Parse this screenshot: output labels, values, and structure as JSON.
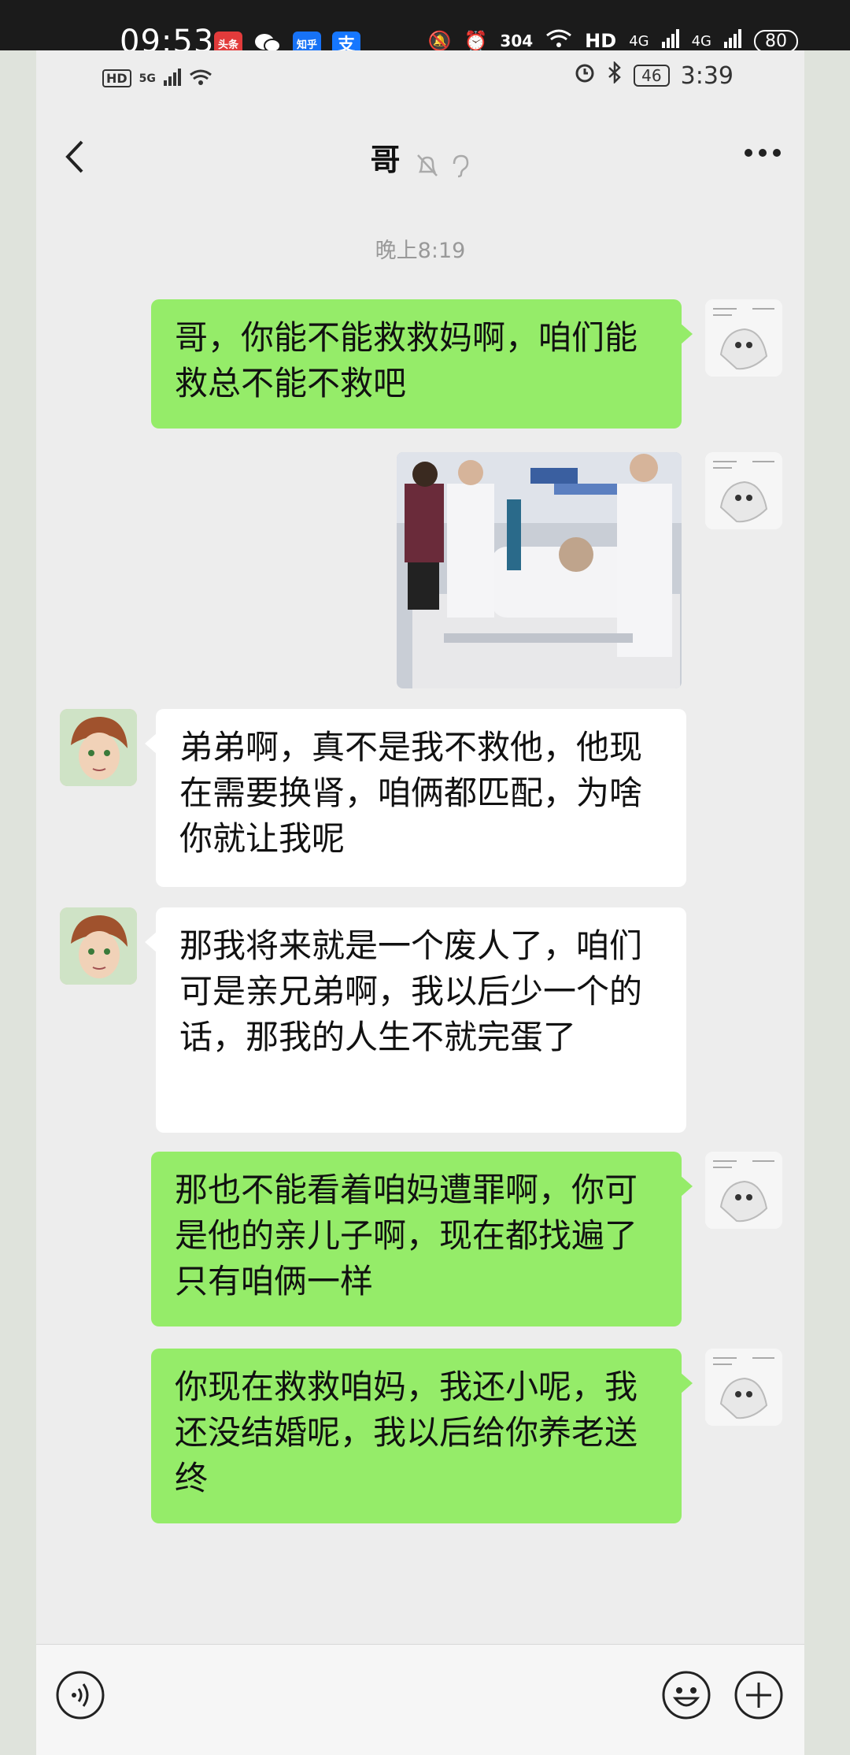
{
  "outer_status": {
    "time": "09:53",
    "apps": [
      "头条",
      "微信",
      "知乎",
      "支"
    ],
    "net_speed": "304",
    "hd": "HD",
    "signal1": "4G",
    "signal2": "4G",
    "battery": "80"
  },
  "inner_status": {
    "hd": "HD",
    "net": "5G",
    "battery": "46",
    "time": "3:39"
  },
  "chat": {
    "title": "哥",
    "timestamp": "晚上8:19",
    "messages": [
      {
        "from": "me",
        "text": "哥，你能不能救救妈啊，咱们能救总不能不救吧"
      },
      {
        "from": "me",
        "type": "image"
      },
      {
        "from": "brother",
        "text": "弟弟啊，真不是我不救他，他现在需要换肾，咱俩都匹配，为啥你就让我呢"
      },
      {
        "from": "brother",
        "text": "那我将来就是一个废人了，咱们可是亲兄弟啊，我以后少一个的话，那我的人生不就完蛋了"
      },
      {
        "from": "me",
        "text": "那也不能看着咱妈遭罪啊，你可是他的亲儿子啊，现在都找遍了只有咱俩一样"
      },
      {
        "from": "me",
        "text": "你现在救救咱妈，我还小呢，我还没结婚呢，我以后给你养老送终"
      }
    ]
  },
  "colors": {
    "my_bubble": "#95ec69",
    "other_bubble": "#ffffff",
    "background": "#ededed"
  }
}
